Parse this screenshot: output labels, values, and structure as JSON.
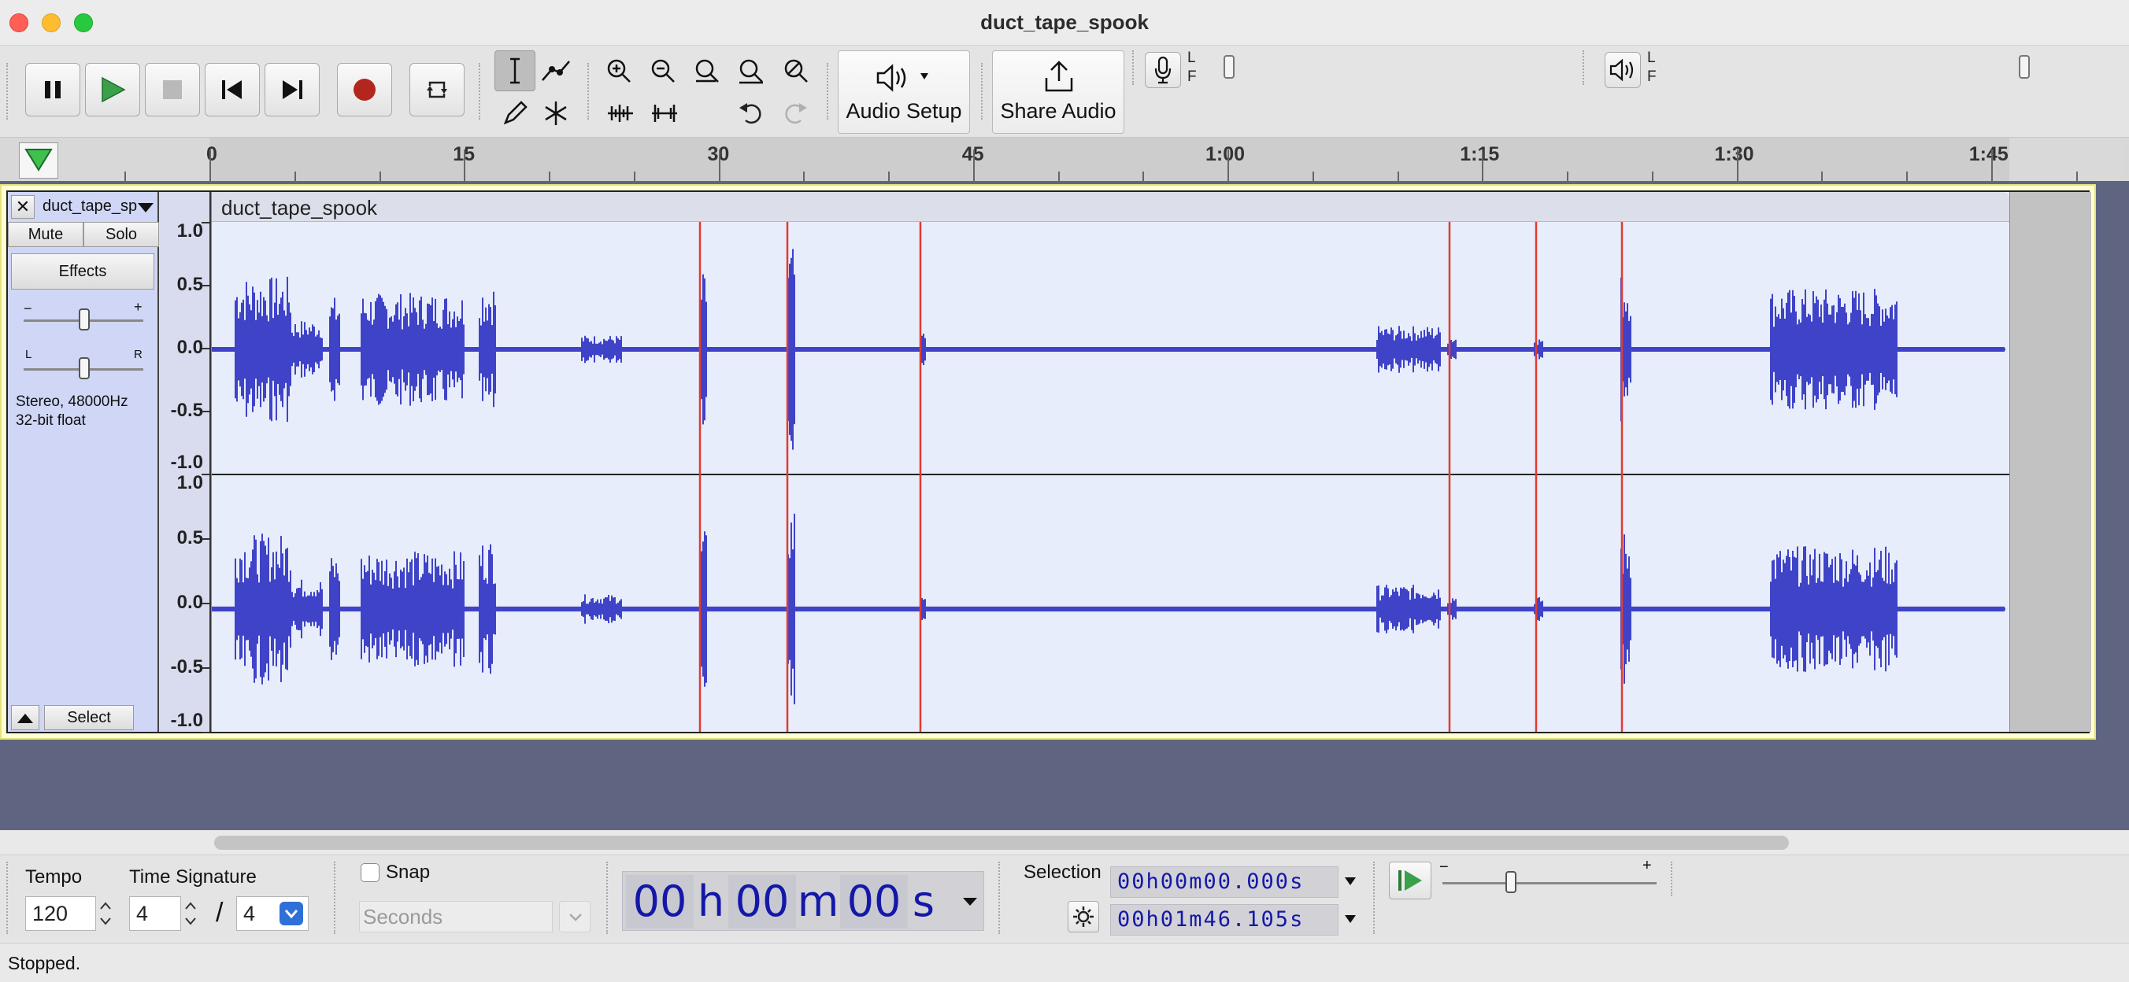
{
  "window": {
    "title": "duct_tape_spook"
  },
  "toolbar": {
    "audio_setup_label": "Audio Setup",
    "share_audio_label": "Share Audio",
    "record_meter": {
      "top": "L",
      "bottom": "F"
    },
    "play_meter": {
      "top": "L",
      "bottom": "F"
    }
  },
  "ruler": {
    "labels": [
      "0",
      "15",
      "30",
      "45",
      "1:00",
      "1:15",
      "1:30",
      "1:45"
    ]
  },
  "track": {
    "name": "duct_tape_sp",
    "mute_label": "Mute",
    "solo_label": "Solo",
    "effects_label": "Effects",
    "gain_minus": "−",
    "gain_plus": "+",
    "pan_left": "L",
    "pan_right": "R",
    "info_line1": "Stereo, 48000Hz",
    "info_line2": "32-bit float",
    "select_label": "Select",
    "clip_name": "duct_tape_spook",
    "amplitude_labels": [
      "1.0",
      "0.5",
      "0.0",
      "-0.5",
      "-1.0"
    ]
  },
  "bottom": {
    "tempo_label": "Tempo",
    "tempo_value": "120",
    "time_signature_label": "Time Signature",
    "ts_numerator": "4",
    "ts_slash": "/",
    "ts_denominator": "4",
    "snap_label": "Snap",
    "snap_unit": "Seconds",
    "time_hours": "00",
    "time_h": "h",
    "time_minutes": "00",
    "time_m": "m",
    "time_seconds": "00",
    "time_s": "s",
    "selection_label": "Selection",
    "selection_start": "00h00m00.000s",
    "selection_end": "00h01m46.105s",
    "speed_minus": "−",
    "speed_plus": "+"
  },
  "status": {
    "text": "Stopped."
  }
}
